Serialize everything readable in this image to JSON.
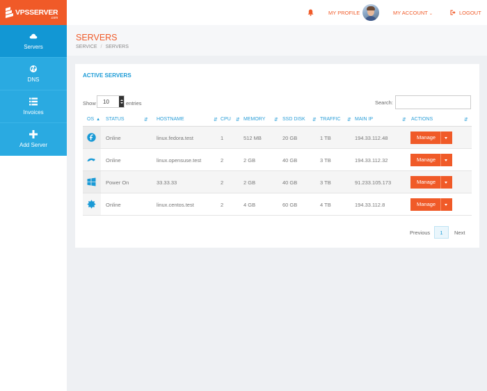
{
  "brand": {
    "name": "VPSSERVER",
    "suffix": ".com",
    "color": "#f05a28"
  },
  "sidebar": {
    "items": [
      {
        "label": "Servers",
        "icon": "cloud-icon",
        "active": true
      },
      {
        "label": "DNS",
        "icon": "globe-icon",
        "active": false
      },
      {
        "label": "Invoices",
        "icon": "list-icon",
        "active": false
      },
      {
        "label": "Add Server",
        "icon": "plus-icon",
        "active": false
      }
    ]
  },
  "topbar": {
    "profile_label": "MY PROFILE",
    "account_label": "MY ACCOUNT",
    "logout_label": "LOGOUT"
  },
  "page": {
    "title": "SERVERS",
    "breadcrumb": [
      "SERVICE",
      "SERVERS"
    ]
  },
  "card": {
    "title": "ACTIVE SERVERS",
    "show_label": "Show",
    "entries_value": "10",
    "entries_label": "entries",
    "search_label": "Search:",
    "search_value": ""
  },
  "table": {
    "columns": [
      "OS",
      "STATUS",
      "HOSTNAME",
      "CPU",
      "MEMORY",
      "SSD DISK",
      "TRAFFIC",
      "MAIN IP",
      "ACTIONS"
    ],
    "rows": [
      {
        "os_icon": "fedora-icon",
        "status": "Online",
        "hostname": "linux.fedora.test",
        "cpu": "1",
        "memory": "512 MB",
        "disk": "20 GB",
        "traffic": "1 TB",
        "ip": "194.33.112.48",
        "action": "Manage"
      },
      {
        "os_icon": "opensuse-icon",
        "status": "Online",
        "hostname": "linux.opensuse.test",
        "cpu": "2",
        "memory": "2 GB",
        "disk": "40 GB",
        "traffic": "3 TB",
        "ip": "194.33.112.32",
        "action": "Manage"
      },
      {
        "os_icon": "windows-icon",
        "status": "Power On",
        "hostname": "33.33.33",
        "cpu": "2",
        "memory": "2 GB",
        "disk": "40 GB",
        "traffic": "3 TB",
        "ip": "91.233.105.173",
        "action": "Manage"
      },
      {
        "os_icon": "centos-icon",
        "status": "Online",
        "hostname": "linux.centos.test",
        "cpu": "2",
        "memory": "4 GB",
        "disk": "60 GB",
        "traffic": "4 TB",
        "ip": "194.33.112.8",
        "action": "Manage"
      }
    ]
  },
  "pagination": {
    "previous_label": "Previous",
    "current_page": "1",
    "next_label": "Next"
  },
  "colors": {
    "accent": "#f05a28",
    "nav": "#2aaae1",
    "nav_active": "#1297d4",
    "link": "#1a9ad6"
  }
}
